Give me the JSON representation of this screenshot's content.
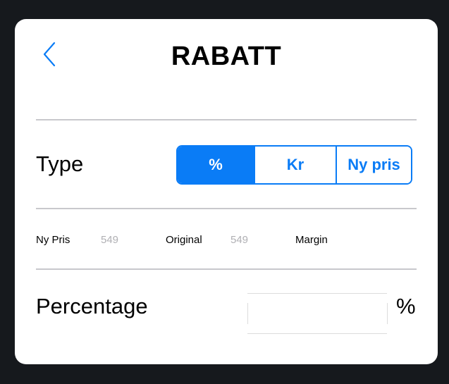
{
  "header": {
    "title": "RABATT",
    "back_icon": "chevron-left-icon"
  },
  "colors": {
    "accent": "#0a7cf6",
    "background": "#16191d",
    "card": "#ffffff",
    "divider": "#c8c8cc",
    "muted_value": "#b0b0b4"
  },
  "type_section": {
    "label": "Type",
    "options": [
      {
        "label": "%",
        "selected": true
      },
      {
        "label": "Kr",
        "selected": false
      },
      {
        "label": "Ny pris",
        "selected": false
      }
    ]
  },
  "info_row": {
    "new_price_label": "Ny Pris",
    "new_price_value": "549",
    "original_label": "Original",
    "original_value": "549",
    "margin_label": "Margin"
  },
  "percentage_section": {
    "label": "Percentage",
    "input_value": "",
    "unit": "%"
  }
}
